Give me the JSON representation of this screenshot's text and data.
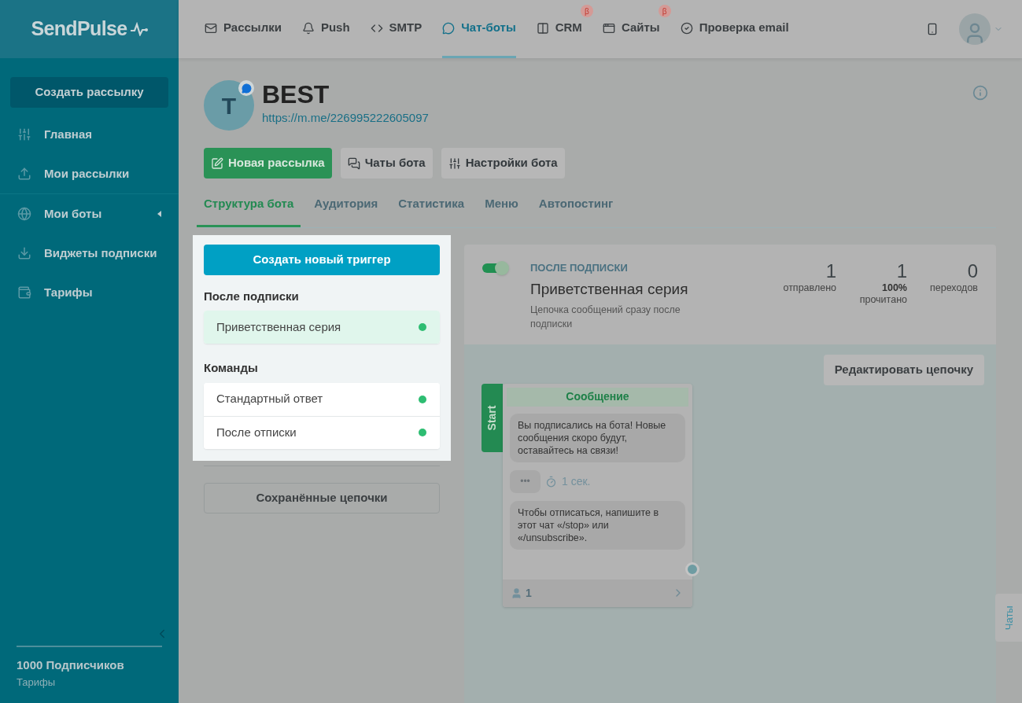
{
  "logo": "SendPulse",
  "sidebar": {
    "create_button": "Создать рассылку",
    "items": [
      {
        "label": "Главная",
        "expandable": false
      },
      {
        "label": "Мои рассылки",
        "expandable": false
      },
      {
        "label": "Мои боты",
        "expandable": true
      },
      {
        "label": "Виджеты подписки",
        "expandable": false
      },
      {
        "label": "Тарифы",
        "expandable": false
      }
    ],
    "footer": {
      "subscribers": "1000 Подписчиков",
      "plan": "Тарифы"
    }
  },
  "topnav": [
    {
      "label": "Рассылки",
      "selected": false,
      "beta": false
    },
    {
      "label": "Push",
      "selected": false,
      "beta": false
    },
    {
      "label": "SMTP",
      "selected": false,
      "beta": false
    },
    {
      "label": "Чат-боты",
      "selected": true,
      "beta": false
    },
    {
      "label": "CRM",
      "selected": false,
      "beta": true,
      "badge": "β"
    },
    {
      "label": "Сайты",
      "selected": false,
      "beta": true,
      "badge": "β"
    },
    {
      "label": "Проверка email",
      "selected": false,
      "beta": false
    }
  ],
  "bot": {
    "avatar_letter": "T",
    "name": "BEST",
    "link": "https://m.me/226995222605097"
  },
  "actions": [
    {
      "label": "Новая рассылка",
      "kind": "primary"
    },
    {
      "label": "Чаты бота",
      "kind": "secondary"
    },
    {
      "label": "Настройки бота",
      "kind": "secondary"
    }
  ],
  "tabs": [
    {
      "label": "Структура бота",
      "selected": true
    },
    {
      "label": "Аудитория",
      "selected": false
    },
    {
      "label": "Статистика",
      "selected": false
    },
    {
      "label": "Меню",
      "selected": false
    },
    {
      "label": "Автопостинг",
      "selected": false
    }
  ],
  "triggers": {
    "create_button": "Создать новый триггер",
    "groups": [
      {
        "title": "После подписки",
        "items": [
          {
            "label": "Приветственная серия",
            "selected": true,
            "active": true
          }
        ]
      },
      {
        "title": "Команды",
        "items": [
          {
            "label": "Стандартный ответ",
            "selected": false,
            "active": true
          },
          {
            "label": "После отписки",
            "selected": false,
            "active": true
          }
        ]
      }
    ],
    "saved_button": "Сохранённые цепочки"
  },
  "chain": {
    "on": true,
    "category": "ПОСЛЕ ПОДПИСКИ",
    "title": "Приветственная серия",
    "description": "Цепочка сообщений сразу после подписки",
    "stats": [
      {
        "value": "1",
        "label": "отправлено"
      },
      {
        "value": "1",
        "percent": "100%",
        "label": "прочитано"
      },
      {
        "value": "0",
        "label": "переходов"
      }
    ],
    "edit_button": "Редактировать цепочку",
    "node": {
      "start": "Start",
      "title": "Сообщение",
      "count": "1",
      "blocks": [
        {
          "kind": "text",
          "text": "Вы подписались на бота! Новые сообщения скоро будут, оставайтесь на связи!"
        },
        {
          "kind": "delay",
          "dots": "•••",
          "text": "1 сек."
        },
        {
          "kind": "text",
          "text": "Чтобы отписаться, напишите в этот чат «/stop» или «/unsubscribe»."
        }
      ]
    }
  },
  "chats_tab": "Чаты"
}
